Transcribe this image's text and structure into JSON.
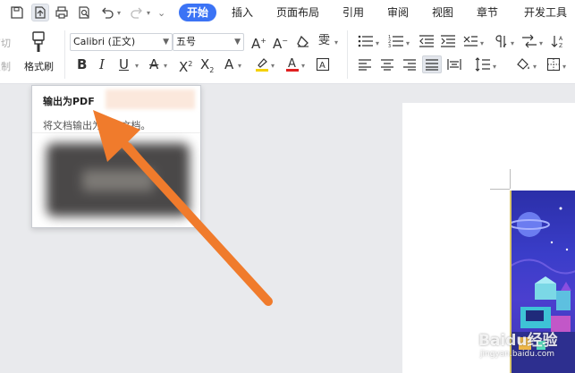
{
  "menubar": {
    "tabs": [
      {
        "label": "开始",
        "active": true
      },
      {
        "label": "插入"
      },
      {
        "label": "页面布局"
      },
      {
        "label": "引用"
      },
      {
        "label": "审阅"
      },
      {
        "label": "视图"
      },
      {
        "label": "章节"
      },
      {
        "label": "开发工具"
      }
    ]
  },
  "ribbon": {
    "cut_label": "剪切",
    "copy_label": "复制",
    "format_painter_label": "格式刷",
    "font_name": "Calibri (正文)",
    "font_size": "五号"
  },
  "tooltip": {
    "title": "输出为PDF",
    "description": "将文档输出为PDF文档。"
  },
  "watermark": {
    "text": "Baidu经验",
    "subtext": "jingyan.baidu.com"
  },
  "colors": {
    "accent": "#3b73f5",
    "arrow": "#f07b2c",
    "highlight_yellow": "#f5d100",
    "font_color_red": "#e02020"
  }
}
